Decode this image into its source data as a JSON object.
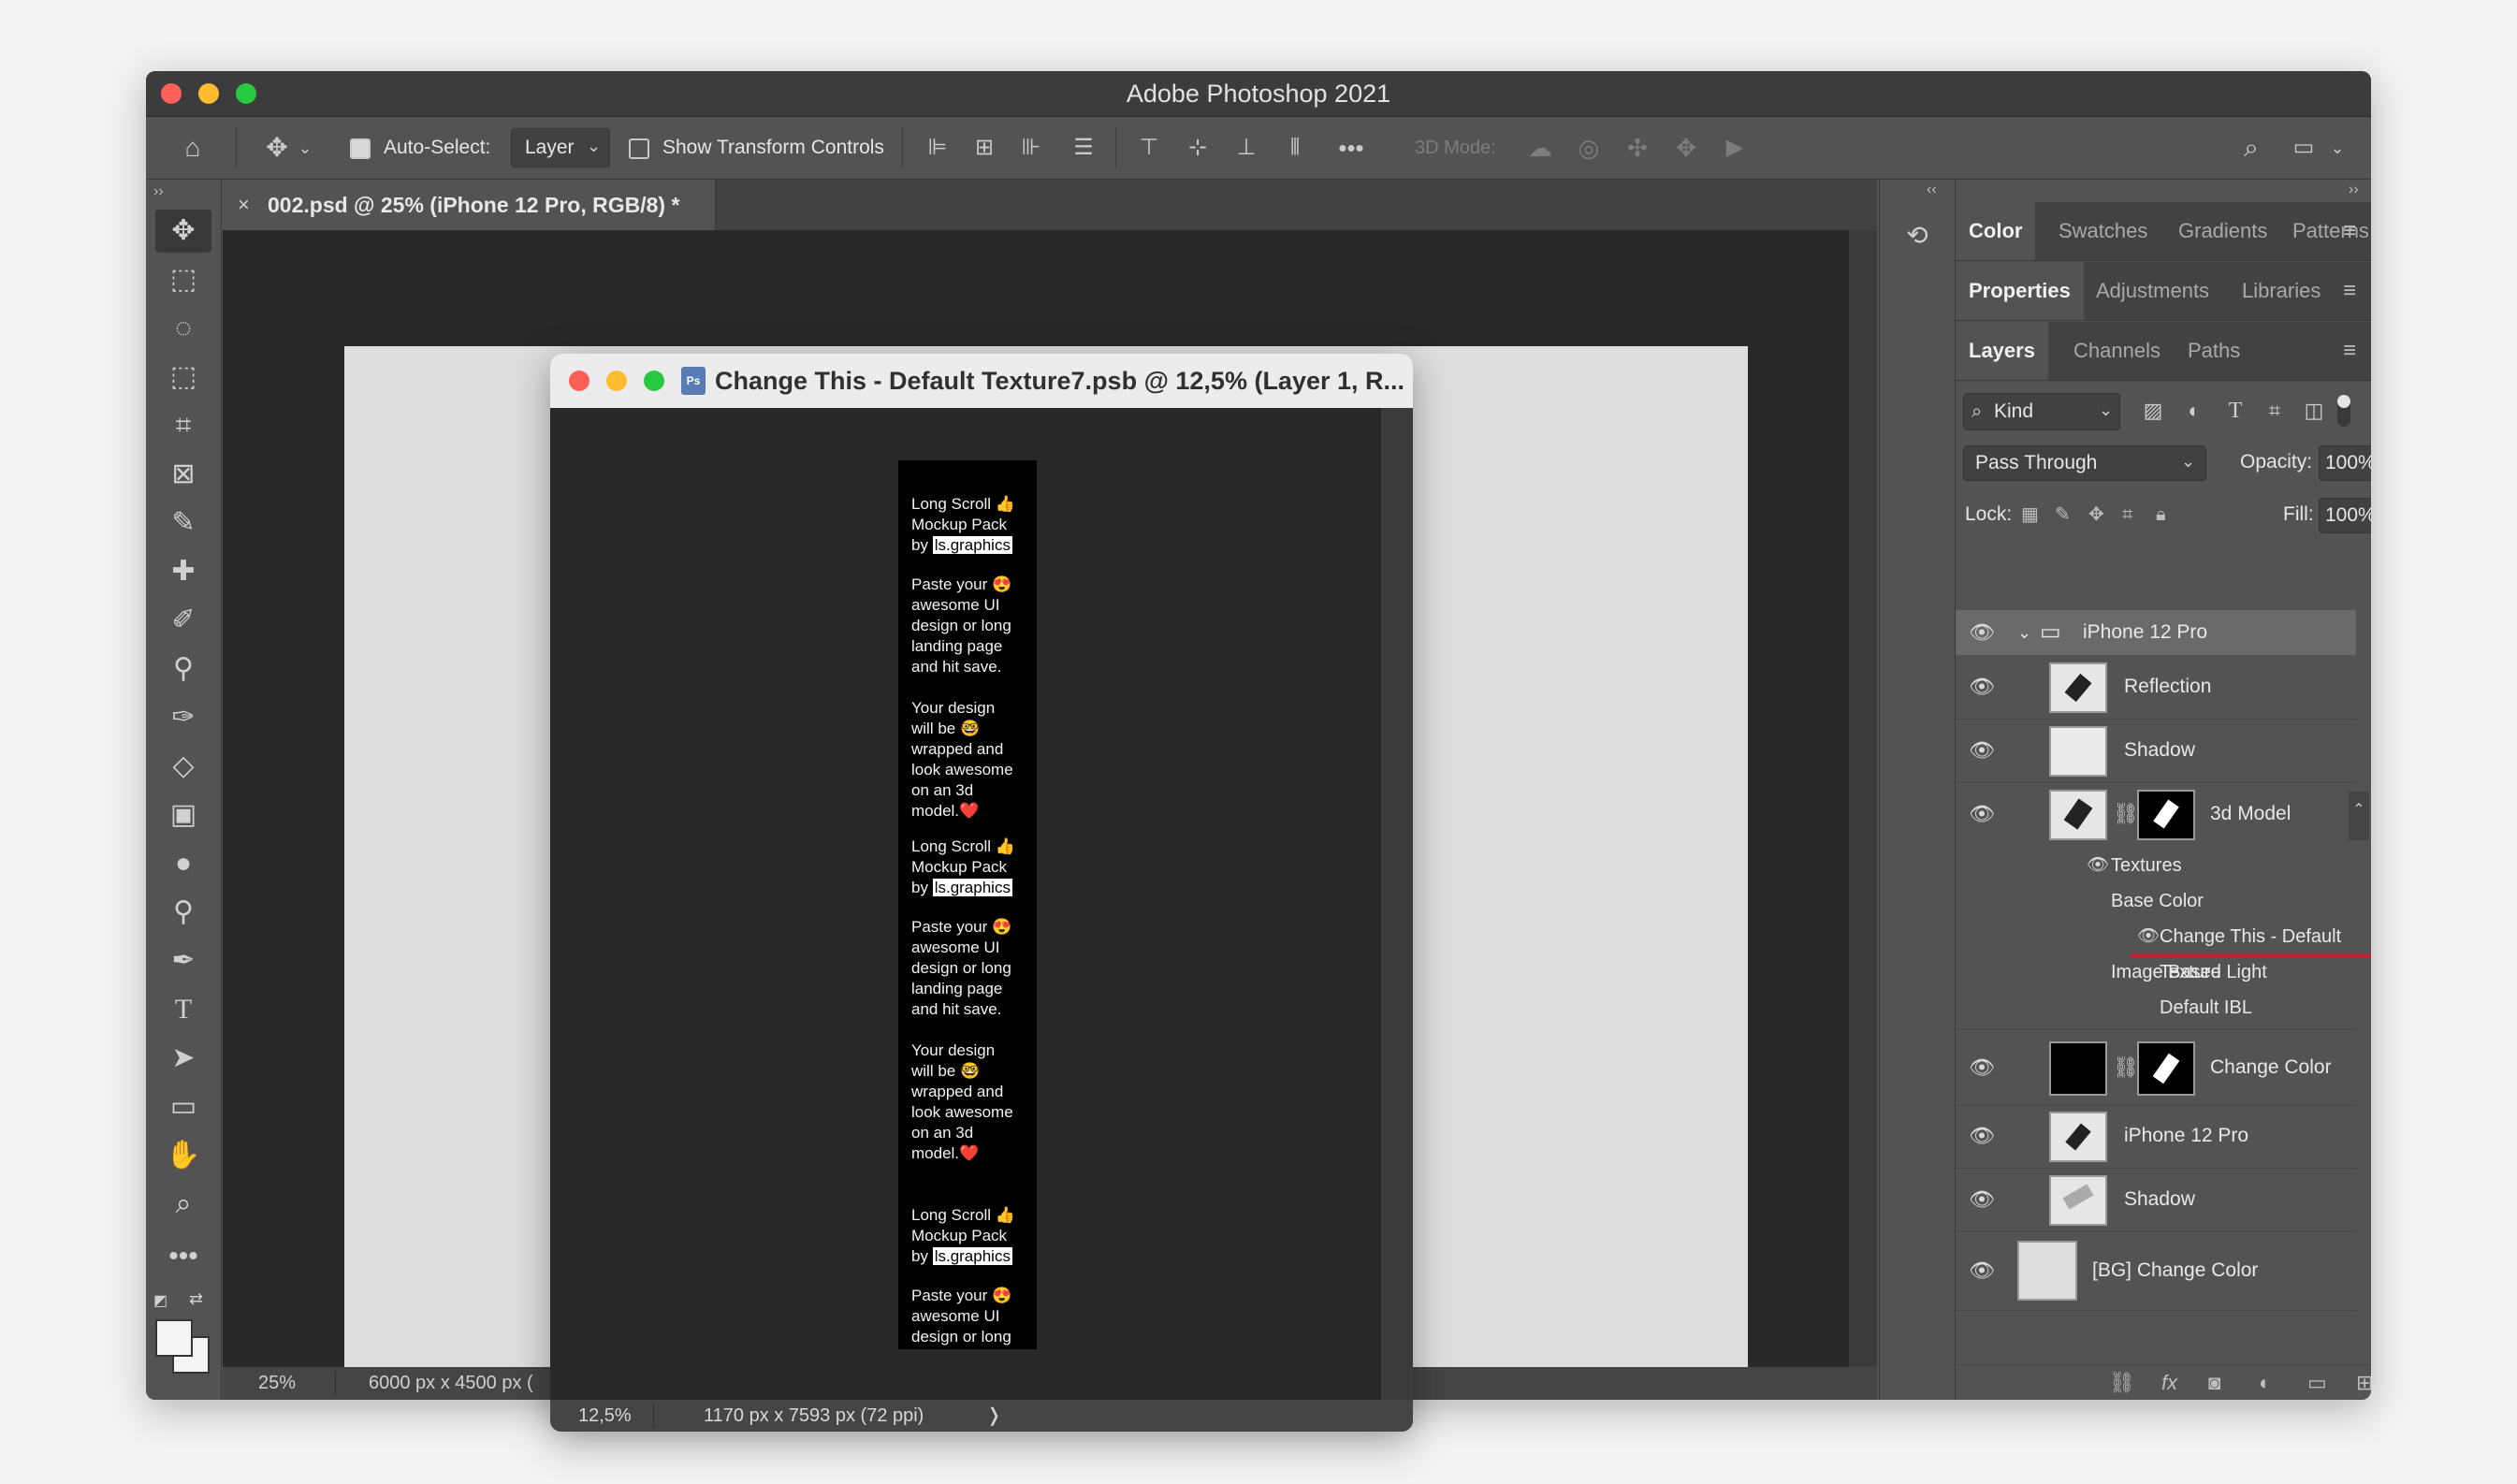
{
  "window": {
    "title": "Adobe Photoshop 2021"
  },
  "options_bar": {
    "auto_select_label": "Auto-Select:",
    "auto_select_value": "Layer",
    "show_transform_label": "Show Transform Controls",
    "mode_3d_label": "3D Mode:"
  },
  "document": {
    "tab_title": "002.psd @ 25% (iPhone 12 Pro, RGB/8) *",
    "zoom": "25%",
    "size_info": "6000 px x 4500 px ("
  },
  "floating_doc": {
    "title": "Change This - Default Texture7.psb @ 12,5% (Layer 1, R...",
    "zoom": "12,5%",
    "size_info": "1170 px x 7593 px (72 ppi)",
    "arrow": "❭",
    "badge": "Ps"
  },
  "phone_content": {
    "block1": [
      "Long Scroll 👍",
      "Mockup Pack"
    ],
    "by_prefix": "by ",
    "brand": "ls.graphics",
    "block2": [
      "Paste your 😍",
      "awesome UI",
      "design or long",
      "landing page",
      "and hit save."
    ],
    "block3": [
      "Your design",
      "will be 🤓",
      "wrapped and",
      "look awesome",
      "on an 3d",
      "model.❤️"
    ],
    "block4": [
      "Paste your 😍",
      "awesome UI",
      "design or long"
    ]
  },
  "panel_tabs_1": [
    "Color",
    "Swatches",
    "Gradients",
    "Patterns"
  ],
  "panel_tabs_2": [
    "Properties",
    "Adjustments",
    "Libraries"
  ],
  "panel_tabs_3": [
    "Layers",
    "Channels",
    "Paths"
  ],
  "layers_panel": {
    "filter_kind": "Kind",
    "blend_mode": "Pass Through",
    "opacity_label": "Opacity:",
    "opacity_value": "100%",
    "lock_label": "Lock:",
    "fill_label": "Fill:",
    "fill_value": "100%",
    "group_name": "iPhone 12 Pro",
    "layers": [
      {
        "name": "Reflection"
      },
      {
        "name": "Shadow"
      },
      {
        "name": "3d Model"
      },
      {
        "name": "Change Color"
      },
      {
        "name": "iPhone 12 Pro"
      },
      {
        "name": "Shadow"
      },
      {
        "name": "[BG] Change Color"
      }
    ],
    "textures_tree": {
      "textures": "Textures",
      "base_color": "Base Color",
      "change_this": "Change This - Default Texture",
      "ibl": "Image Based Light",
      "default_ibl": "Default IBL"
    }
  },
  "colors": {
    "accent_underline": "#c8242b",
    "close": "#fe5f57",
    "minimize": "#febc2e",
    "maximize": "#28c840"
  }
}
